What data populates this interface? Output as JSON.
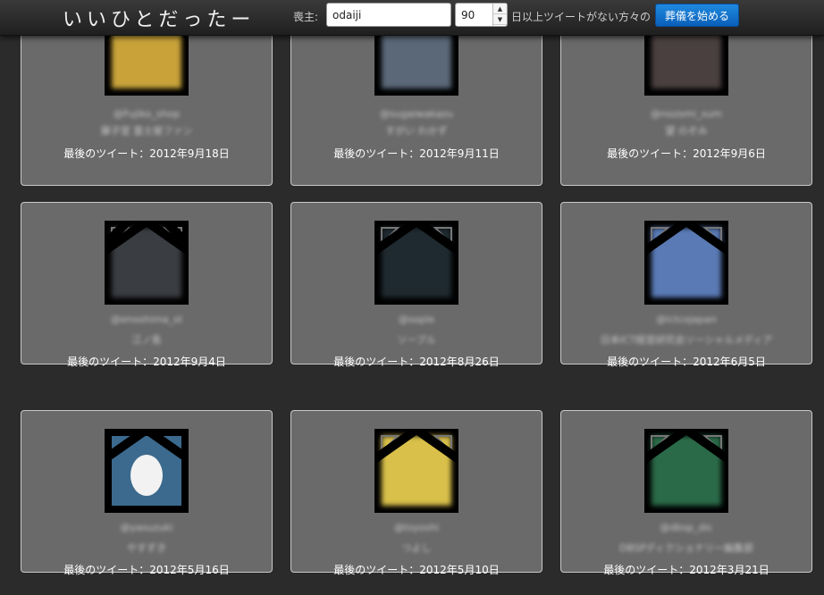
{
  "header": {
    "logo": "いいひとだったー",
    "mourner_label": "喪主:",
    "user_value": "odaiji",
    "days_value": "90",
    "spin_up": "▲",
    "spin_down": "▼",
    "suffix_label": "日以上ツイートがない方々の",
    "start_button": "葬儀を始める"
  },
  "cards": [
    {
      "handle": "@Fujiko_shop",
      "name": "藤子堂 富士屋ファン",
      "last_tweet": "最後のツイート：2012年9月18日",
      "color": "#c9a33a"
    },
    {
      "handle": "@sugaiwakazu",
      "name": "すがい わかず",
      "last_tweet": "最後のツイート：2012年9月11日",
      "color": "#5a6878"
    },
    {
      "handle": "@nozomi_sum",
      "name": "望 のぞみ",
      "last_tweet": "最後のツイート：2012年9月6日",
      "color": "#4a4040"
    },
    {
      "handle": "@enoshima_st",
      "name": "江ノ島",
      "last_tweet": "最後のツイート：2012年9月4日",
      "color": "#3a3d42"
    },
    {
      "handle": "@sople",
      "name": "ソープル",
      "last_tweet": "最後のツイート：2012年8月26日",
      "color": "#1f2a30"
    },
    {
      "handle": "@ictcojapan",
      "name": "日本ICT経営研究会ソーシャルメディア",
      "last_tweet": "最後のツイート：2012年6月5日",
      "color": "#5a7ab5"
    },
    {
      "handle": "@yasuzuki",
      "name": "やすずき",
      "last_tweet": "最後のツイート：2012年5月16日",
      "color": "#3b6a8e"
    },
    {
      "handle": "@tsyoshi",
      "name": "つよし",
      "last_tweet": "最後のツイート：2012年5月10日",
      "color": "#d9c04a"
    },
    {
      "handle": "@dbsp_dic",
      "name": "DBSPディクショナリー編集部",
      "last_tweet": "最後のツイート：2012年3月21日",
      "color": "#2a6a48"
    }
  ]
}
